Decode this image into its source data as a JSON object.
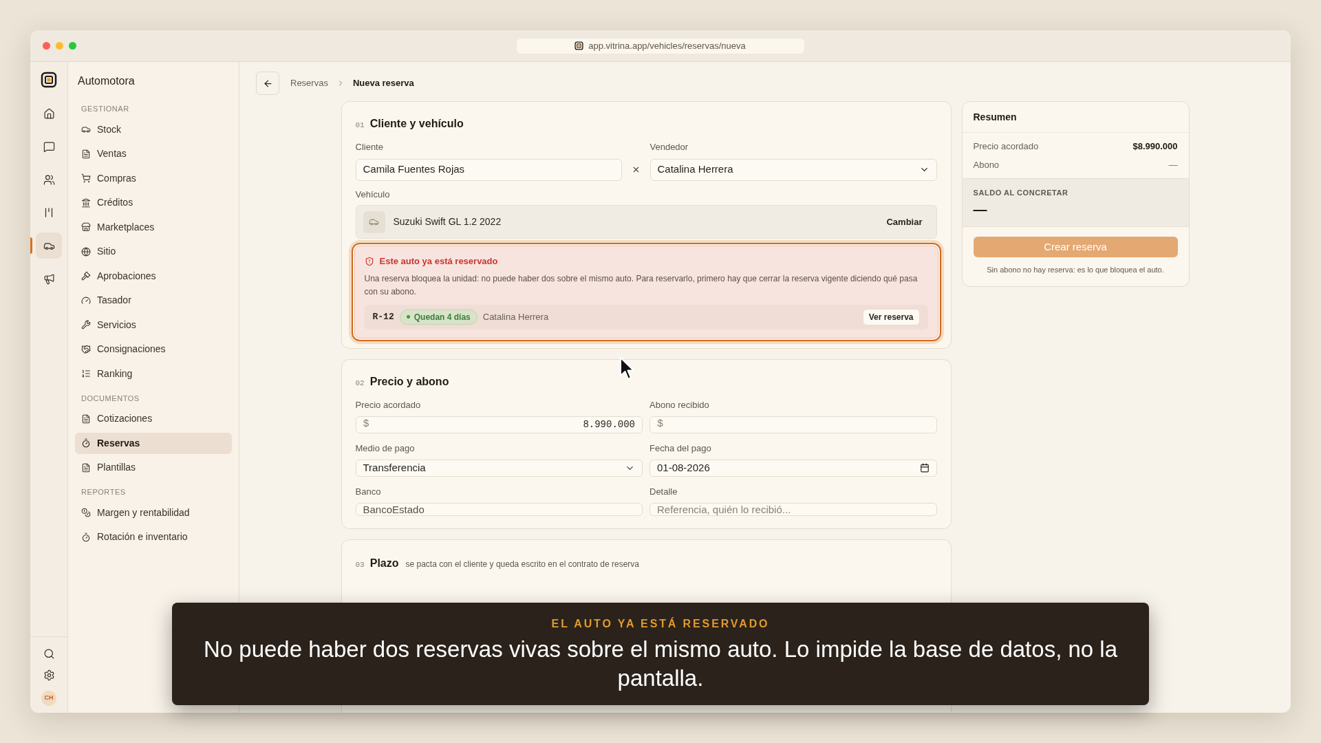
{
  "browser": {
    "url": "app.vitrina.app/vehicles/reservas/nueva"
  },
  "app": {
    "name": "Automotora"
  },
  "rail": [
    {
      "kind": "home",
      "selected": false
    },
    {
      "kind": "chat",
      "selected": false
    },
    {
      "kind": "users",
      "selected": false
    },
    {
      "kind": "bars",
      "selected": false
    },
    {
      "kind": "car",
      "selected": true
    },
    {
      "kind": "megaphone",
      "selected": false
    }
  ],
  "rail_bottom": {
    "avatar": "CH"
  },
  "sidebar": [
    {
      "title": "GESTIONAR",
      "items": [
        {
          "label": "Stock",
          "kind": "car",
          "selected": false
        },
        {
          "label": "Ventas",
          "kind": "doc",
          "selected": false
        },
        {
          "label": "Compras",
          "kind": "cart",
          "selected": false
        },
        {
          "label": "Créditos",
          "kind": "bank",
          "selected": false
        },
        {
          "label": "Marketplaces",
          "kind": "store",
          "selected": false
        },
        {
          "label": "Sitio",
          "kind": "globe",
          "selected": false
        },
        {
          "label": "Aprobaciones",
          "kind": "gavel",
          "selected": false
        },
        {
          "label": "Tasador",
          "kind": "gauge",
          "selected": false
        },
        {
          "label": "Servicios",
          "kind": "wrench",
          "selected": false
        },
        {
          "label": "Consignaciones",
          "kind": "handshake",
          "selected": false
        },
        {
          "label": "Ranking",
          "kind": "list",
          "selected": false
        }
      ]
    },
    {
      "title": "DOCUMENTOS",
      "items": [
        {
          "label": "Cotizaciones",
          "kind": "doc",
          "selected": false
        },
        {
          "label": "Reservas",
          "kind": "timer",
          "selected": true
        },
        {
          "label": "Plantillas",
          "kind": "doc",
          "selected": false
        }
      ]
    },
    {
      "title": "REPORTES",
      "items": [
        {
          "label": "Margen y rentabilidad",
          "kind": "coins",
          "selected": false
        },
        {
          "label": "Rotación e inventario",
          "kind": "timer",
          "selected": false
        }
      ]
    }
  ],
  "breadcrumb": {
    "parent": "Reservas",
    "current": "Nueva reserva"
  },
  "client_vehicle": {
    "number": "01",
    "title": "Cliente y vehículo",
    "client_label": "Cliente",
    "client_value": "Camila Fuentes Rojas",
    "seller_label": "Vendedor",
    "seller_value": "Catalina Herrera",
    "vehicle_label": "Vehículo",
    "vehicle_value": "Suzuki Swift GL 1.2 2022",
    "change_button": "Cambiar",
    "alert": {
      "title": "Este auto ya está reservado",
      "text": "Una reserva bloquea la unidad: no puede haber dos sobre el mismo auto. Para reservarlo, primero hay que cerrar la reserva vigente diciendo qué pasa con su abono.",
      "code": "R-12",
      "badge": "Quedan 4 días",
      "seller": "Catalina Herrera",
      "button": "Ver reserva"
    }
  },
  "price": {
    "number": "02",
    "title": "Precio y abono",
    "fields": [
      {
        "label": "Precio acordado",
        "kind": "money",
        "prefix": "$",
        "value": "8.990.000"
      },
      {
        "label": "Abono recibido",
        "kind": "money",
        "prefix": "$"
      },
      {
        "label": "Medio de pago",
        "kind": "select",
        "value": "Transferencia"
      },
      {
        "label": "Fecha del pago",
        "kind": "date",
        "value": "01-08-2026"
      },
      {
        "label": "Banco",
        "kind": "text",
        "value": "BancoEstado"
      },
      {
        "label": "Detalle",
        "kind": "text",
        "placeholder": "Referencia, quién lo recibió..."
      }
    ]
  },
  "term": {
    "number": "03",
    "title": "Plazo",
    "subtitle": "se pacta con el cliente y queda escrito en el contrato de reserva"
  },
  "summary": {
    "title": "Resumen",
    "rows": [
      {
        "label": "Precio acordado",
        "value": "$8.990.000",
        "kind": "amount"
      },
      {
        "label": "Abono",
        "value": "—",
        "kind": "empty"
      }
    ],
    "balance_label": "SALDO AL CONCRETAR",
    "balance_value": "—",
    "button": {
      "label": "Crear reserva",
      "disabled": true
    },
    "note": "Sin abono no hay reserva: es lo que bloquea el auto."
  },
  "caption": {
    "kicker": "EL AUTO YA ESTÁ RESERVADO",
    "text": "No puede haber dos reservas vivas sobre el mismo auto. Lo impide la base de datos, no la pantalla."
  }
}
